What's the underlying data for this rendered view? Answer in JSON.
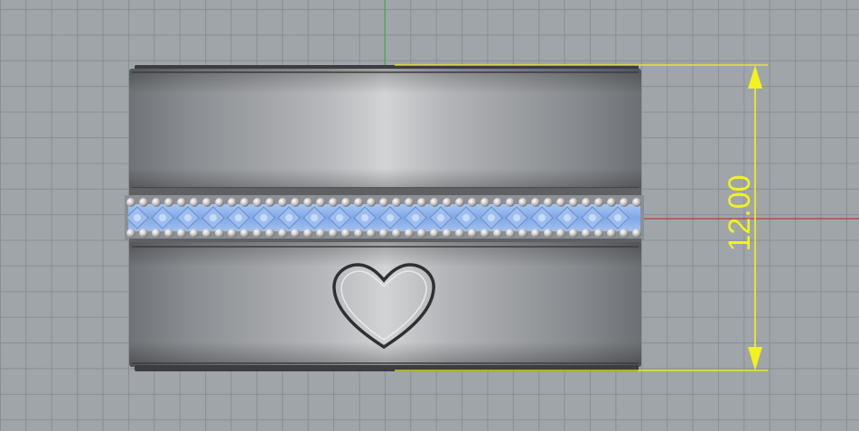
{
  "viewport": {
    "background_color": "#a0a5aa",
    "grid_color": "#878c92",
    "y_axis_color": "#3fae47",
    "x_axis_color": "#c0393b"
  },
  "dimension": {
    "value_label": "12.00",
    "color": "#f2f21c"
  },
  "model": {
    "body_color": "#8e9094",
    "highlight_color": "#d4d5d7",
    "stone_color": "#8fb4ec",
    "bead_color": "#d6d6d6",
    "engraving": "heart-icon"
  }
}
